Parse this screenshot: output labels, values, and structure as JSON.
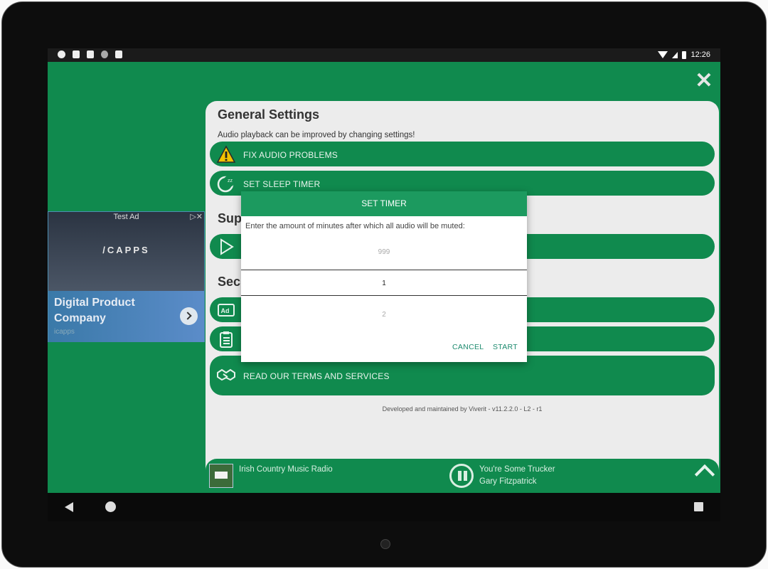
{
  "statusbar": {
    "time": "12:26",
    "left_icons": [
      "app-icon",
      "a-icon",
      "signal-bars-icon",
      "dot-icon",
      "sd-card-icon"
    ],
    "right_icons": [
      "wifi-icon",
      "cell-signal-icon",
      "battery-icon"
    ]
  },
  "general": {
    "title": "General Settings",
    "description": "Audio playback can be improved by changing settings!",
    "fix_audio": "FIX AUDIO PROBLEMS",
    "sleep_timer": "SET SLEEP TIMER"
  },
  "support": {
    "title_partial": "Sup"
  },
  "security": {
    "title_partial": "Sec"
  },
  "terms": {
    "label": "READ OUR TERMS AND SERVICES"
  },
  "footer": {
    "developed": "Developed and maintained by Viverit - v11.2.2.0 - L2 - r1"
  },
  "ad": {
    "test_label": "Test Ad",
    "brand": "/CAPPS",
    "title": "Digital Product Company",
    "subtitle": "icapps"
  },
  "dialog": {
    "title": "SET TIMER",
    "message": "Enter the amount of minutes after which all audio will be muted:",
    "picker_prev": "999",
    "picker_current": "1",
    "picker_next": "2",
    "cancel": "CANCEL",
    "start": "START"
  },
  "player": {
    "station": "Irish Country Music Radio",
    "song": "You're Some Trucker",
    "artist": "Gary Fitzpatrick"
  },
  "colors": {
    "accent": "#108a4e",
    "dialog_header": "#1c9a5f",
    "panel": "#ececec",
    "button_text": "#1c8a6e"
  }
}
